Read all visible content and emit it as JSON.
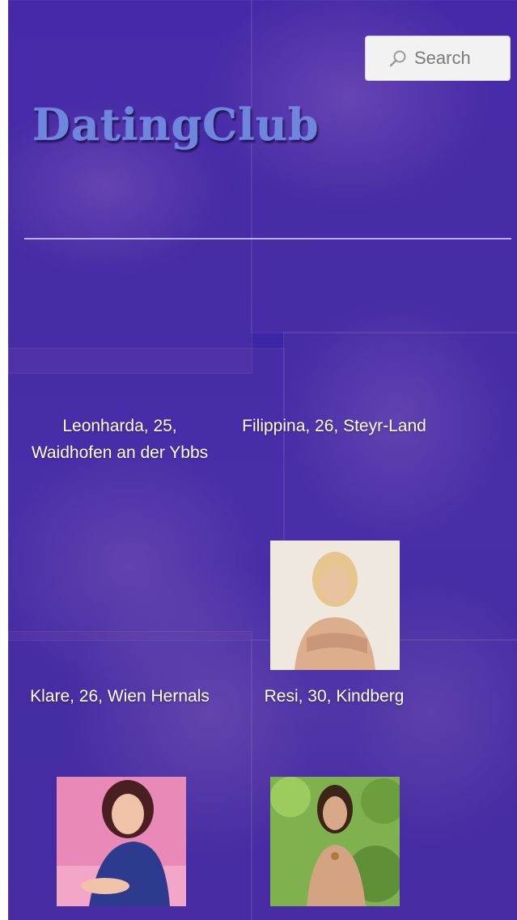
{
  "search": {
    "label": "Search"
  },
  "logo": {
    "text": "DatingClub"
  },
  "profiles": [
    {
      "caption": "Leonharda, 25, Waidhofen an der Ybbs"
    },
    {
      "caption": "Filippina, 26, Steyr-Land"
    },
    {
      "caption": "Klare, 26, Wien Hernals"
    },
    {
      "caption": "Resi, 30, Kindberg"
    }
  ],
  "icons": {
    "search": "magnifier-icon"
  },
  "colors": {
    "background": "#3b23a4",
    "logo": "#6f86de",
    "text": "#ffffff"
  }
}
